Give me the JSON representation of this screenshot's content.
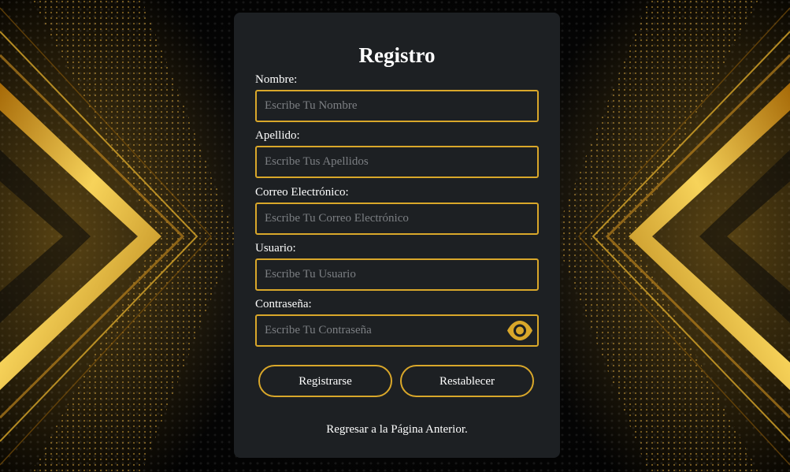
{
  "form": {
    "title": "Registro",
    "fields": [
      {
        "label": "Nombre:",
        "placeholder": "Escribe Tu Nombre",
        "value": ""
      },
      {
        "label": "Apellido:",
        "placeholder": "Escribe Tus Apellidos",
        "value": ""
      },
      {
        "label": "Correo Electrónico:",
        "placeholder": "Escribe Tu Correo Electrónico",
        "value": ""
      },
      {
        "label": "Usuario:",
        "placeholder": "Escribe Tu Usuario",
        "value": ""
      },
      {
        "label": "Contraseña:",
        "placeholder": "Escribe Tu Contraseña",
        "value": ""
      }
    ],
    "password_toggle_icon": "eye-icon",
    "register_label": "Registrarse",
    "reset_label": "Restablecer",
    "back_link": "Regresar a la Página Anterior."
  },
  "theme": {
    "accent": "#d9a72a",
    "card_bg": "#1d2023",
    "page_bg": "#000000",
    "text": "#ffffff",
    "placeholder": "#7c7f83"
  }
}
